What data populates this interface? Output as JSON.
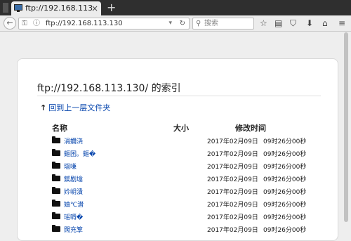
{
  "tab": {
    "title": "ftp://192.168.113.13...",
    "close": "×"
  },
  "newtab": "+",
  "nav": {
    "back": "←",
    "url": "ftp://192.168.113.130",
    "search_placeholder": "搜索",
    "dropdown": "▾",
    "reload": "↻",
    "tools": [
      "☆",
      "▤",
      "⛉",
      "⬇",
      "⌂",
      "≡"
    ]
  },
  "page": {
    "heading": "ftp://192.168.113.130/ 的索引",
    "up_arrow": "↑",
    "up_link": "回到上一层文件夹",
    "columns": {
      "name": "名称",
      "size": "大小",
      "modified": "修改时间"
    },
    "rows": [
      {
        "name": "涓嬭浇",
        "date": "2017年02月09日",
        "time": "09时26分00秒"
      },
      {
        "name": "鏂囨。鏂�",
        "date": "2017年02月09日",
        "time": "09时26分00秒"
      },
      {
        "name": "瑙嗛",
        "date": "2017年02月09日",
        "time": "09时26分00秒"
      },
      {
        "name": "鍥剧墖",
        "date": "2017年02月09日",
        "time": "09时26分00秒"
      },
      {
        "name": "妗岄潰",
        "date": "2017年02月09日",
        "time": "09时26分00秒"
      },
      {
        "name": "妯℃澘",
        "date": "2017年02月09日",
        "time": "09时26分00秒"
      },
      {
        "name": "瑶嗕�",
        "date": "2017年02月09日",
        "time": "09时26分00秒"
      },
      {
        "name": "闊充箰",
        "date": "2017年02月09日",
        "time": "09时26分00秒"
      }
    ]
  },
  "colors": {
    "link": "#0645ad",
    "chrome": "#2f2f2f",
    "toolbar": "#ececec"
  }
}
